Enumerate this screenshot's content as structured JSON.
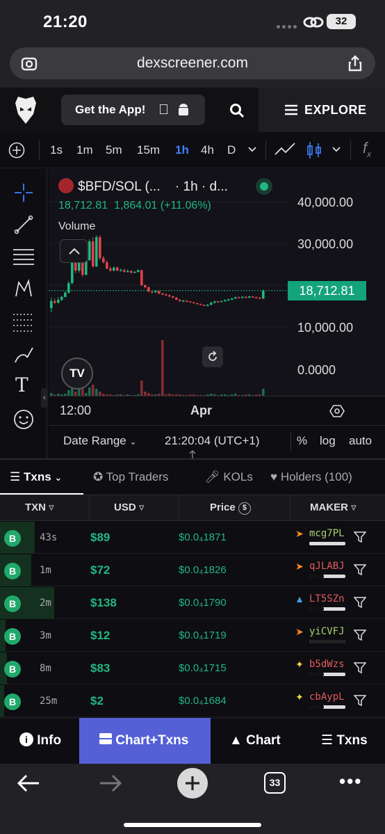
{
  "status_bar": {
    "time": "21:20",
    "battery": "32"
  },
  "browser": {
    "url": "dexscreener.com",
    "tab_count": "33"
  },
  "header": {
    "get_app": "Get the App!",
    "explore": "EXPLORE"
  },
  "toolbar": {
    "timeframes": [
      "1s",
      "1m",
      "5m",
      "15m",
      "1h",
      "4h",
      "D"
    ],
    "selected": "1h"
  },
  "chart": {
    "pair": "$BFD/SOL (...",
    "interval": "· 1h · d...",
    "price_line": "18,712.81",
    "change_line": "1,864.01 (+11.06%)",
    "volume_label": "Volume",
    "y_ticks": [
      "40,000.00",
      "30,000.00",
      "10,000.00",
      "0.0000"
    ],
    "current_price": "18,712.81",
    "x_ticks": [
      "12:00",
      "Apr"
    ],
    "date_range": "Date Range",
    "clock": "21:20:04 (UTC+1)",
    "pct": "%",
    "log": "log",
    "auto": "auto",
    "up_color": "#21b780",
    "down_color": "#e0434d"
  },
  "chart_data": {
    "type": "candlestick",
    "title": "$BFD/SOL",
    "ylim": [
      0,
      45000
    ],
    "last": 18712.81,
    "change": 1864.01,
    "change_pct": 11.06
  },
  "tabs": {
    "txns": "Txns",
    "top_traders": "Top Traders",
    "kols": "KOLs",
    "holders": "Holders (100)"
  },
  "table": {
    "headers": {
      "txn": "TXN",
      "usd": "USD",
      "price": "Price",
      "maker": "MAKER"
    },
    "rows": [
      {
        "type": "B",
        "age": "43s",
        "usd": "$89",
        "price": "$0.0₄1871",
        "maker": "mcg7PL",
        "maker_color": "#a8d36b",
        "icon": "fire-icon"
      },
      {
        "type": "B",
        "age": "1m",
        "usd": "$72",
        "price": "$0.0₄1826",
        "maker": "qJLABJ",
        "maker_color": "#e25b5b",
        "icon": "fire-icon"
      },
      {
        "type": "B",
        "age": "2m",
        "usd": "$138",
        "price": "$0.0₄1790",
        "maker": "LT5SZn",
        "maker_color": "#e25b5b",
        "icon": "dolphin-icon"
      },
      {
        "type": "B",
        "age": "3m",
        "usd": "$12",
        "price": "$0.0₄1719",
        "maker": "yiCVFJ",
        "maker_color": "#a8d36b",
        "icon": "fire-icon"
      },
      {
        "type": "B",
        "age": "8m",
        "usd": "$83",
        "price": "$0.0₄1715",
        "maker": "b5dWzs",
        "maker_color": "#e25b5b",
        "icon": "sparkle-icon"
      },
      {
        "type": "B",
        "age": "25m",
        "usd": "$2",
        "price": "$0.0₄1684",
        "maker": "cbAypL",
        "maker_color": "#e25b5b",
        "icon": "sparkle-icon"
      }
    ]
  },
  "bottom_nav": {
    "info": "Info",
    "chart_txns": "Chart+Txns",
    "chart": "Chart",
    "txns": "Txns"
  }
}
